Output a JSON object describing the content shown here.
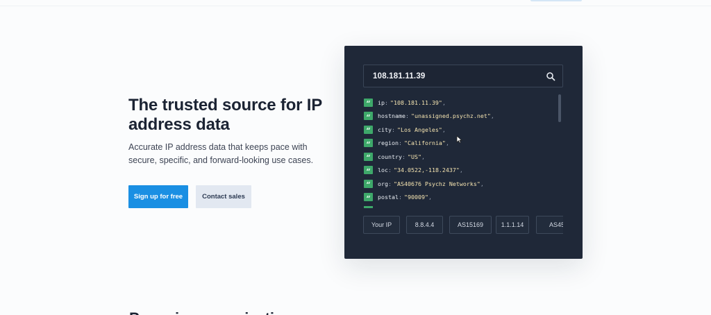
{
  "hero": {
    "title": "The trusted source for IP address data",
    "subtitle": "Accurate IP address data that keeps pace with secure, specific, and forward-looking use cases.",
    "primary_button": "Sign up for free",
    "secondary_button": "Contact sales"
  },
  "demo": {
    "search_value": "108.181.11.39",
    "search_icon": "search-icon",
    "quote_glyph": "“",
    "fields": [
      {
        "key": "ip",
        "value": "\"108.181.11.39\""
      },
      {
        "key": "hostname",
        "value": "\"unassigned.psychz.net\""
      },
      {
        "key": "city",
        "value": "\"Los Angeles\""
      },
      {
        "key": "region",
        "value": "\"California\""
      },
      {
        "key": "country",
        "value": "\"US\""
      },
      {
        "key": "loc",
        "value": "\"34.0522,-118.2437\""
      },
      {
        "key": "org",
        "value": "\"AS40676 Psychz Networks\""
      },
      {
        "key": "postal",
        "value": "\"90009\""
      }
    ],
    "colon": ":",
    "comma": ",",
    "chips": [
      "Your IP",
      "8.8.4.4",
      "AS15169",
      "1.1.1.14",
      "AS45"
    ]
  },
  "next_section": {
    "heading": "Powering organizations"
  },
  "colors": {
    "panel_bg": "#1f2838",
    "accent_blue": "#1a8fe3",
    "quote_green": "#3ea86a"
  }
}
